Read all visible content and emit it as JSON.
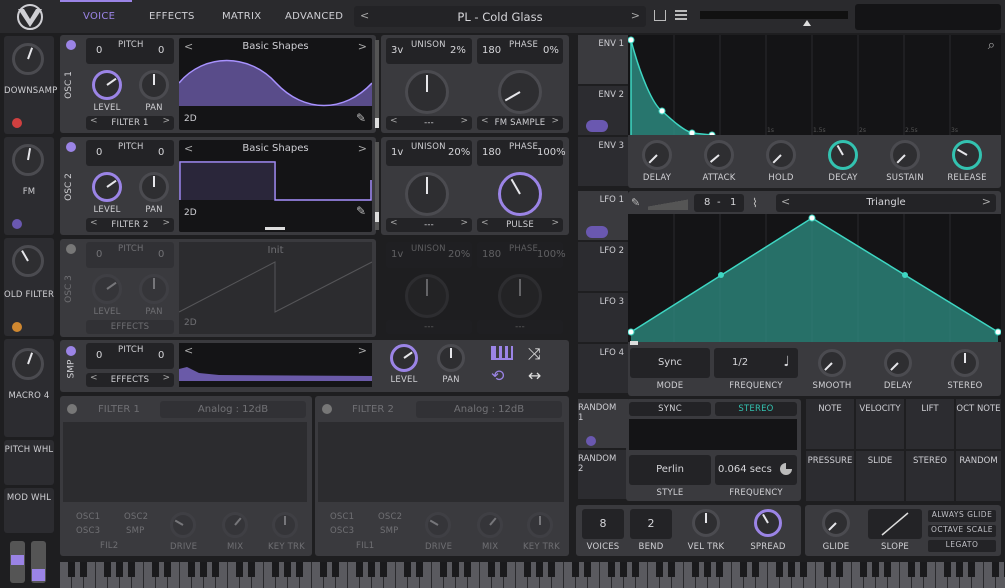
{
  "nav": {
    "tabs": [
      "VOICE",
      "EFFECTS",
      "MATRIX",
      "ADVANCED"
    ],
    "preset": "PL - Cold Glass"
  },
  "left": {
    "macros": [
      "DOWNSAMP",
      "FM",
      "OLD FILTER",
      "MACRO 4"
    ],
    "wheels": [
      "PITCH WHL",
      "MOD WHL"
    ]
  },
  "osc1": {
    "label": "OSC 1",
    "pitch": "PITCH",
    "p1": "0",
    "p2": "0",
    "wave": "Basic Shapes",
    "dim": "2D",
    "unison": "UNISON",
    "voices": "3v",
    "detune": "2%",
    "phase": "PHASE",
    "ph1": "180",
    "ph2": "0%",
    "level": "LEVEL",
    "pan": "PAN",
    "dest": "FILTER 1",
    "m1": "---",
    "m2": "FM SAMPLE"
  },
  "osc2": {
    "label": "OSC 2",
    "pitch": "PITCH",
    "p1": "0",
    "p2": "0",
    "wave": "Basic Shapes",
    "dim": "2D",
    "unison": "UNISON",
    "voices": "1v",
    "detune": "20%",
    "phase": "PHASE",
    "ph1": "180",
    "ph2": "100%",
    "level": "LEVEL",
    "pan": "PAN",
    "dest": "FILTER 2",
    "m1": "---",
    "m2": "PULSE"
  },
  "osc3": {
    "label": "OSC 3",
    "pitch": "PITCH",
    "p1": "0",
    "p2": "0",
    "wave": "Init",
    "dim": "2D",
    "unison": "UNISON",
    "voices": "1v",
    "detune": "20%",
    "phase": "PHASE",
    "ph1": "180",
    "ph2": "100%",
    "level": "LEVEL",
    "pan": "PAN",
    "dest": "EFFECTS",
    "m1": "---",
    "m2": "---"
  },
  "smp": {
    "label": "SMP",
    "pitch": "PITCH",
    "p1": "0",
    "p2": "0",
    "level": "LEVEL",
    "pan": "PAN",
    "dest": "EFFECTS"
  },
  "filter1": {
    "title": "FILTER 1",
    "type": "Analog : 12dB",
    "drive": "DRIVE",
    "mix": "MIX",
    "keytrk": "KEY TRK",
    "src": [
      "OSC1",
      "OSC2",
      "OSC3",
      "SMP"
    ],
    "fil": "FIL2"
  },
  "filter2": {
    "title": "FILTER 2",
    "type": "Analog : 12dB",
    "drive": "DRIVE",
    "mix": "MIX",
    "keytrk": "KEY TRK",
    "src": [
      "OSC1",
      "OSC2",
      "OSC3",
      "SMP"
    ],
    "fil": "FIL1"
  },
  "env": {
    "tabs": [
      "ENV 1",
      "ENV 2",
      "ENV 3"
    ],
    "knobs": [
      "DELAY",
      "ATTACK",
      "HOLD",
      "DECAY",
      "SUSTAIN",
      "RELEASE"
    ],
    "ticks": [
      "1s",
      "1.5s",
      "2s",
      "2.5s",
      "3s",
      "3.5s"
    ]
  },
  "lfo": {
    "tabs": [
      "LFO 1",
      "LFO 2",
      "LFO 3",
      "LFO 4"
    ],
    "ratio": "8",
    "ratio2": "1",
    "shape": "Triangle",
    "mode": "Sync",
    "mode_lbl": "MODE",
    "freq": "1/2",
    "freq_lbl": "FREQUENCY",
    "smooth": "SMOOTH",
    "delay": "DELAY",
    "stereo": "STEREO"
  },
  "random": {
    "tabs": [
      "RANDOM 1",
      "RANDOM 2"
    ],
    "sync": "SYNC",
    "stereo": "STEREO",
    "style": "Perlin",
    "style_lbl": "STYLE",
    "freq": "0.064 secs",
    "freq_lbl": "FREQUENCY"
  },
  "mods": [
    "NOTE",
    "VELOCITY",
    "LIFT",
    "OCT NOTE",
    "PRESSURE",
    "SLIDE",
    "STEREO",
    "RANDOM"
  ],
  "voice": {
    "voices": "8",
    "voices_lbl": "VOICES",
    "bend": "2",
    "bend_lbl": "BEND",
    "veltrk": "VEL TRK",
    "spread": "SPREAD",
    "glide": "GLIDE",
    "slope": "SLOPE",
    "always": "ALWAYS GLIDE",
    "octave": "OCTAVE SCALE",
    "legato": "LEGATO"
  },
  "colors": {
    "accent": "#9b84e6",
    "teal": "#33c2b0",
    "bg": "#1e1e20",
    "panel": "#3a3a3e"
  }
}
